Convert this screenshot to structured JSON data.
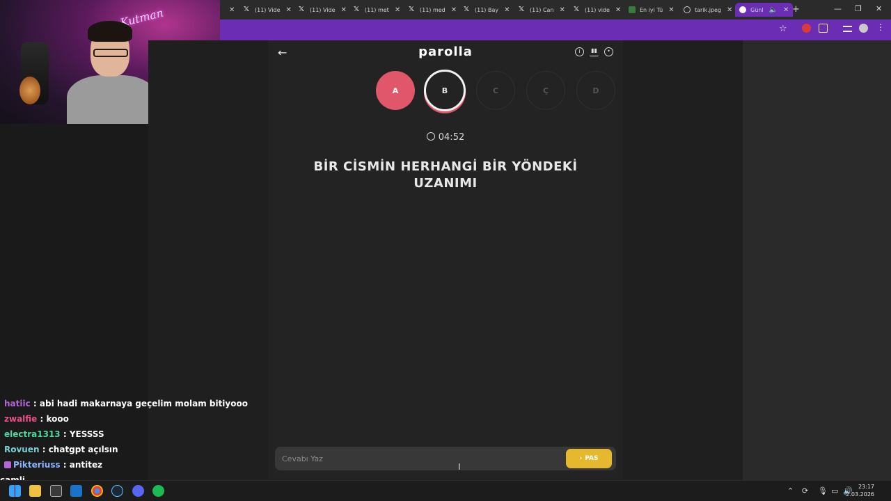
{
  "tabs": [
    {
      "icon": "x-logo-icon",
      "label": "(11) Vide"
    },
    {
      "icon": "x-logo-icon",
      "label": "(11) Vide"
    },
    {
      "icon": "x-logo-icon",
      "label": "(11) met"
    },
    {
      "icon": "x-logo-icon",
      "label": "(11) med"
    },
    {
      "icon": "x-logo-icon",
      "label": "(11) Bay"
    },
    {
      "icon": "x-logo-icon",
      "label": "(11) Can"
    },
    {
      "icon": "x-logo-icon",
      "label": "(11) vide"
    },
    {
      "icon": "image-icon",
      "label": "En iyi Tü"
    },
    {
      "icon": "globe-icon",
      "label": "tarik.jpeg"
    },
    {
      "icon": "chrome-icon",
      "label": "Günl"
    }
  ],
  "webcam": {
    "neon_text": "Kutman"
  },
  "game": {
    "logo": "parolla",
    "letters": [
      {
        "letter": "A",
        "state": "done"
      },
      {
        "letter": "B",
        "state": "current"
      },
      {
        "letter": "C",
        "state": "todo"
      },
      {
        "letter": "Ç",
        "state": "todo"
      },
      {
        "letter": "D",
        "state": "todo"
      }
    ],
    "timer": "04:52",
    "question": "BİR CİSMİN HERHANGİ BİR YÖNDEKİ UZANIMI",
    "answer_placeholder": "Cevabı Yaz",
    "answer_value": "",
    "pass_label": "PAS"
  },
  "chat": [
    {
      "user": "hatiic",
      "color": "#b565d8",
      "message": "abi hadi makarnaya geçelim molam bitiyooo",
      "badge": false
    },
    {
      "user": "zwalfie",
      "color": "#e8508a",
      "message": "kooo",
      "badge": false
    },
    {
      "user": "electra1313",
      "color": "#4fd6a0",
      "message": "YESSSS",
      "badge": false
    },
    {
      "user": "Rovuen",
      "color": "#7ad0d6",
      "message": "chatgpt açılsın",
      "badge": false
    },
    {
      "user": "Pikteriuss",
      "color": "#8ab4ff",
      "message": "antitez",
      "badge": true
    }
  ],
  "chat_partial": "camli",
  "taskbar": {
    "time": "23:17",
    "date": "2.03.2026"
  }
}
